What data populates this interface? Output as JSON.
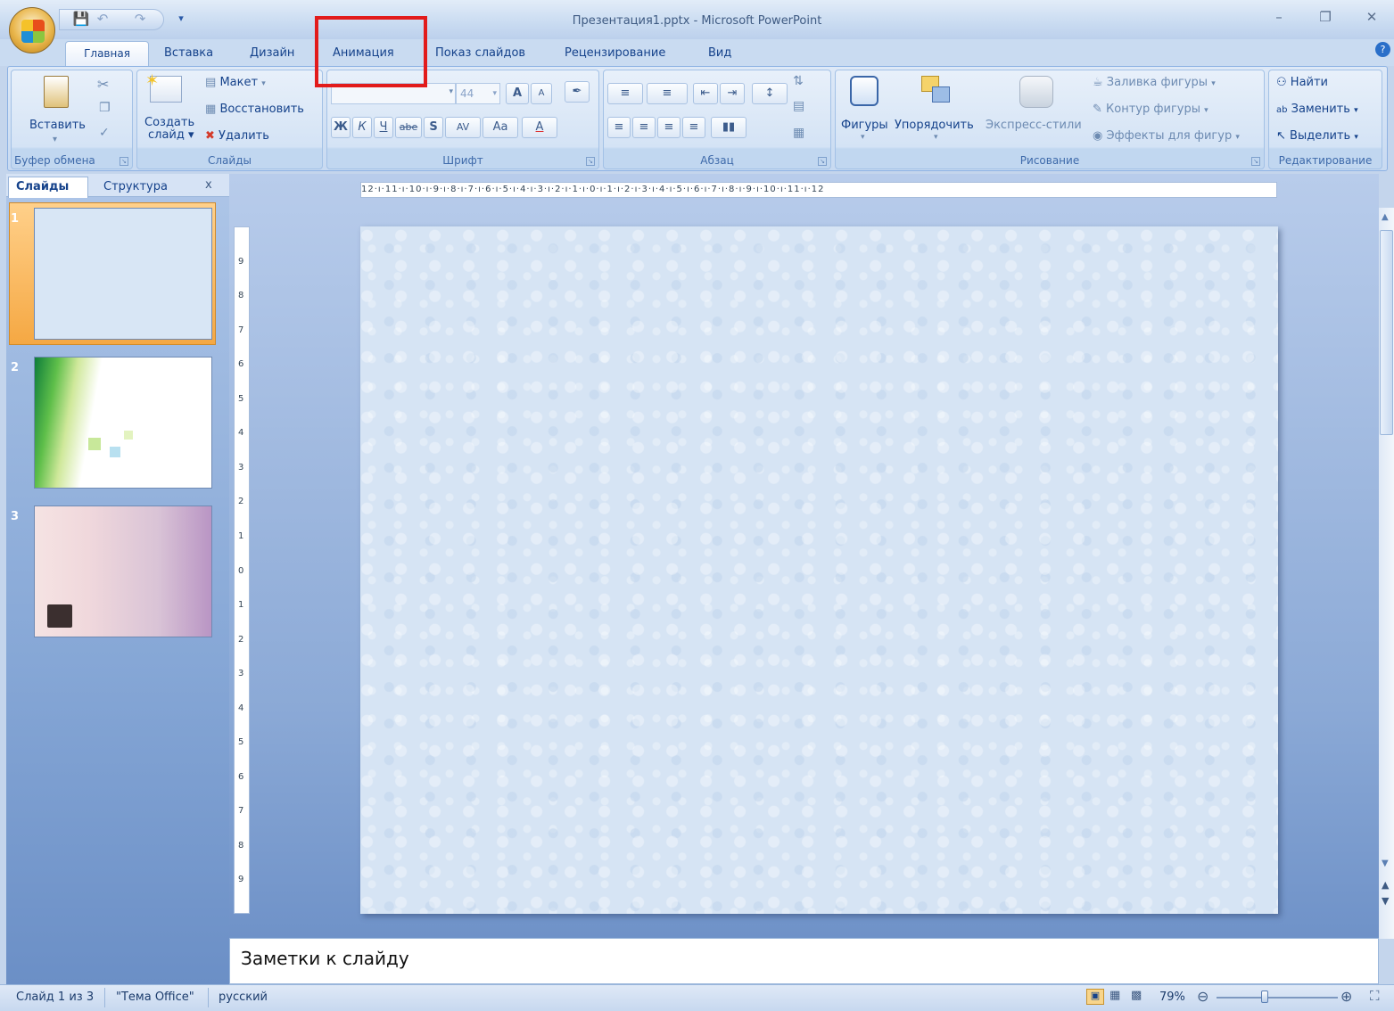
{
  "window": {
    "title": "Презентация1.pptx - Microsoft PowerPoint",
    "min_icon": "minimize-icon",
    "max_icon": "restore-icon",
    "close_icon": "close-icon"
  },
  "quick_access": {
    "items": [
      "save-icon",
      "undo-icon",
      "redo-icon",
      "customize-icon"
    ]
  },
  "tabs": [
    "Главная",
    "Вставка",
    "Дизайн",
    "Анимация",
    "Показ слайдов",
    "Рецензирование",
    "Вид"
  ],
  "ribbon": {
    "clipboard": {
      "label": "Буфер обмена",
      "paste": "Вставить"
    },
    "slides": {
      "label": "Слайды",
      "new_slide_line1": "Создать",
      "new_slide_line2": "слайд",
      "layout": "Макет",
      "reset": "Восстановить",
      "delete": "Удалить"
    },
    "font": {
      "label": "Шрифт",
      "font_name": "",
      "font_size": "44",
      "bold": "Ж",
      "italic": "К",
      "underline": "Ч",
      "strike": "abe",
      "shadow": "S",
      "spacing": "AV",
      "case": "Aa",
      "grow": "A",
      "shrink": "A",
      "color": "A"
    },
    "paragraph": {
      "label": "Абзац"
    },
    "drawing": {
      "label": "Рисование",
      "shapes": "Фигуры",
      "arrange": "Упорядочить",
      "quick_styles": "Экспресс-стили",
      "fill": "Заливка фигуры",
      "outline": "Контур фигуры",
      "effects": "Эффекты для фигур"
    },
    "editing": {
      "label": "Редактирование",
      "find": "Найти",
      "replace": "Заменить",
      "select": "Выделить"
    }
  },
  "left_panel": {
    "tab_slides": "Слайды",
    "tab_outline": "Структура",
    "close": "x",
    "slides": [
      {
        "num": "1"
      },
      {
        "num": "2"
      },
      {
        "num": "3"
      }
    ]
  },
  "ruler": {
    "horizontal": "12·ı·11·ı·10·ı·9·ı·8·ı·7·ı·6·ı·5·ı·4·ı·3·ı·2·ı·1·ı·0·ı·1·ı·2·ı·3·ı·4·ı·5·ı·6·ı·7·ı·8·ı·9·ı·10·ı·11·ı·12",
    "vertical": [
      "9",
      "8",
      "7",
      "6",
      "5",
      "4",
      "3",
      "2",
      "1",
      "0",
      "1",
      "2",
      "3",
      "4",
      "5",
      "6",
      "7",
      "8",
      "9"
    ]
  },
  "notes": {
    "placeholder": "Заметки к слайду"
  },
  "status": {
    "slide_info": "Слайд 1 из 3",
    "theme": "\"Тема Office\"",
    "language": "русский",
    "zoom": "79%",
    "zoom_fraction": 0.79
  }
}
